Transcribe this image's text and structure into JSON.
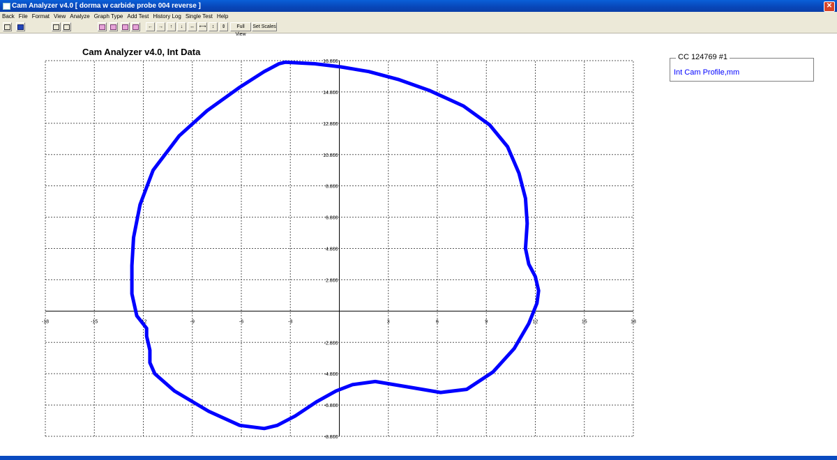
{
  "window": {
    "title": "Cam Analyzer v4.0  [ dorma w carbide probe 004 reverse ]",
    "close_glyph": "✕"
  },
  "menu": [
    "Back",
    "File",
    "Format",
    "View",
    "Analyze",
    "Graph Type",
    "Add Test",
    "History Log",
    "Single Test",
    "Help"
  ],
  "toolbar": {
    "icons": [
      "print-icon",
      "calculator-icon",
      "graph-a-icon",
      "graph-b-icon",
      "zoom-box-icon",
      "zoom-out-icon",
      "prev-icon",
      "next-icon",
      "pan-left-icon",
      "pan-right-icon",
      "pan-up-icon",
      "pan-down-icon",
      "stretch-x-icon",
      "shrink-x-icon",
      "stretch-y-icon",
      "shrink-y-icon"
    ],
    "arrow_glyphs": [
      "←",
      "→",
      "↑",
      "↓",
      "↔",
      "⟷",
      "↕",
      "⇕"
    ],
    "full_view_label": "Full View",
    "set_scales_label": "Set Scales"
  },
  "chart_data": {
    "type": "line",
    "title": "Cam Analyzer v4.0,   Int Data",
    "xlim": [
      -18,
      18
    ],
    "ylim": [
      -8,
      16
    ],
    "x_ticks": [
      "-18",
      "-15",
      "-12",
      "-9",
      "-6",
      "-3",
      "3",
      "6",
      "9",
      "12",
      "15",
      "18"
    ],
    "y_ticks": [
      "16.800",
      "14.800",
      "12.800",
      "10.800",
      "8.800",
      "6.800",
      "4.800",
      "2.800",
      "-2.800",
      "-4.800",
      "-6.800",
      "-8.800"
    ],
    "grid": true,
    "legend_position": "top-right",
    "line_color": "#0000ff",
    "series": [
      {
        "name": "Int Cam Profile,mm",
        "x": [
          -3.3,
          -1.5,
          0.1,
          1.8,
          3.6,
          5.5,
          7.6,
          9.2,
          10.3,
          11.0,
          11.4,
          11.5,
          11.4,
          11.6,
          12.0,
          12.2,
          12.1,
          11.6,
          10.7,
          9.4,
          7.8,
          6.2,
          4.5,
          2.2,
          0.8,
          -0.2,
          -1.4,
          -2.7,
          -3.8,
          -4.6,
          -6.1,
          -8.0,
          -10.1,
          -11.3,
          -11.6,
          -11.6,
          -11.8,
          -11.8,
          -12.4,
          -12.7,
          -12.7,
          -12.6,
          -12.2,
          -11.4,
          -9.8,
          -8.1,
          -6.1,
          -4.6,
          -3.7
        ],
        "y": [
          15.9,
          15.8,
          15.6,
          15.3,
          14.8,
          14.1,
          13.1,
          11.9,
          10.5,
          8.8,
          7.2,
          5.6,
          4.0,
          3.0,
          2.2,
          1.3,
          0.5,
          -0.8,
          -2.4,
          -3.9,
          -5.0,
          -5.2,
          -4.9,
          -4.5,
          -4.7,
          -5.1,
          -5.8,
          -6.7,
          -7.3,
          -7.5,
          -7.3,
          -6.4,
          -5.1,
          -4.0,
          -3.3,
          -2.5,
          -1.6,
          -1.1,
          -0.3,
          1.1,
          2.9,
          4.7,
          6.8,
          9.0,
          11.2,
          12.8,
          14.3,
          15.3,
          15.8
        ]
      }
    ]
  },
  "legend": {
    "title": "CC 124769 #1",
    "entry": "Int Cam Profile,mm"
  }
}
